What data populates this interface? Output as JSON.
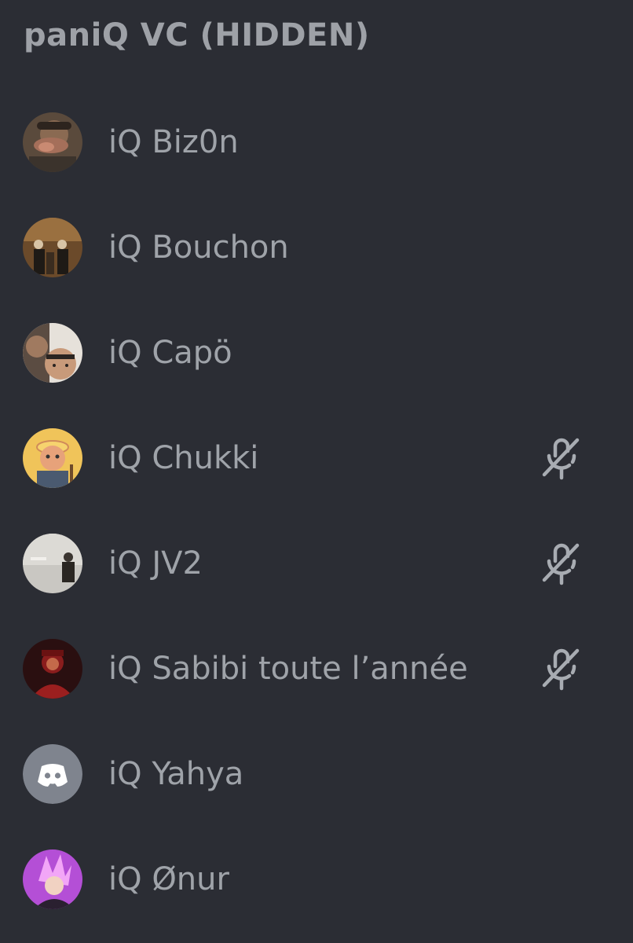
{
  "channel": {
    "title": "paniQ VC (HIDDEN)"
  },
  "members": [
    {
      "name": "iQ Biz0n",
      "muted": false,
      "avatar": "photo-avatar"
    },
    {
      "name": "iQ Bouchon",
      "muted": false,
      "avatar": "photo-avatar"
    },
    {
      "name": "iQ Capö",
      "muted": false,
      "avatar": "photo-avatar"
    },
    {
      "name": "iQ Chukki",
      "muted": true,
      "avatar": "cartoon-avatar"
    },
    {
      "name": "iQ JV2",
      "muted": true,
      "avatar": "photo-avatar"
    },
    {
      "name": "iQ Sabibi toute l’année",
      "muted": true,
      "avatar": "photo-avatar"
    },
    {
      "name": "iQ Yahya",
      "muted": false,
      "avatar": "discord-default-avatar"
    },
    {
      "name": "iQ Ønur",
      "muted": false,
      "avatar": "anime-avatar"
    }
  ],
  "icons": {
    "mute": "microphone-muted-icon"
  },
  "colors": {
    "background": "#2b2d34",
    "text": "#9fa3a9",
    "default_avatar": "#7f848e"
  }
}
